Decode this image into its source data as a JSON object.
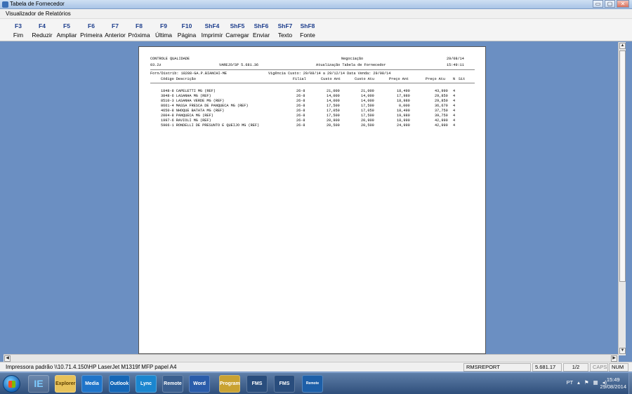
{
  "window": {
    "title": "Tabela de Fornecedor",
    "controls": {
      "minimize": "▭",
      "maximize": "▢",
      "close": "✕"
    }
  },
  "menu": {
    "items": [
      "Visualizador de Relatórios"
    ]
  },
  "toolbar": {
    "keys": [
      {
        "key": "F3",
        "label": "Fim"
      },
      {
        "key": "F4",
        "label": "Reduzir"
      },
      {
        "key": "F5",
        "label": "Ampliar"
      },
      {
        "key": "F6",
        "label": "Primeira"
      },
      {
        "key": "F7",
        "label": "Anterior"
      },
      {
        "key": "F8",
        "label": "Próxima"
      },
      {
        "key": "F9",
        "label": "Última"
      },
      {
        "key": "F10",
        "label": "Página"
      },
      {
        "key": "ShF4",
        "label": "Imprimir"
      },
      {
        "key": "ShF5",
        "label": "Carregar"
      },
      {
        "key": "ShF6",
        "label": "Enviar"
      },
      {
        "key": "ShF7",
        "label": "Texto"
      },
      {
        "key": "ShF8",
        "label": "Fonte"
      }
    ]
  },
  "report": {
    "company": "CONTROLE QUALIDADE",
    "negotiation_label": "Negociação",
    "date": "29/08/14",
    "version_code": "03.2z",
    "system_version": "VAREJO/SP 5.681.36",
    "report_title": "Atualização Tabela de Fornecedor",
    "time": "15:49:11",
    "supplier_line": "Forn/Distrib: 18288-GA.P.BIANCHI-ME",
    "validity_line": "Vigência Custo: 29/08/14 a 29/12/14  Data Venda: 29/08/14",
    "columns": {
      "code_desc": "Código Descrição",
      "filial": "Filial",
      "custo_ant": "Custo Ant",
      "custo_atu": "Custo Atu",
      "preco_ant": "Preço Ant",
      "preco_atu": "Preço Atu",
      "n": "N",
      "sit": "Sit"
    },
    "rows": [
      {
        "desc": "1848-8 CAPELETTI MG (REF)",
        "filial": "26-8",
        "custo_ant": "21,000",
        "custo_atu": "21,000",
        "preco_ant": "18,490",
        "preco_atu": "43,990",
        "n": "4"
      },
      {
        "desc": "3848-6 LASANHA MG (REF)",
        "filial": "26-8",
        "custo_ant": "14,000",
        "custo_atu": "14,000",
        "preco_ant": "17,980",
        "preco_atu": "29,850",
        "n": "4"
      },
      {
        "desc": "8510-3 LASANHA VERDE MG (REF)",
        "filial": "26-8",
        "custo_ant": "14,000",
        "custo_atu": "14,000",
        "preco_ant": "18,980",
        "preco_atu": "29,850",
        "n": "4"
      },
      {
        "desc": "8661-4 MASSA FRESCA DE PANQUECA MG (REF)",
        "filial": "26-8",
        "custo_ant": "17,500",
        "custo_atu": "17,500",
        "preco_ant": "0,000",
        "preco_atu": "36,670",
        "n": "4"
      },
      {
        "desc": "4650-8 NHOQUE BATATA MG (REF)",
        "filial": "26-8",
        "custo_ant": "17,050",
        "custo_atu": "17,050",
        "preco_ant": "18,490",
        "preco_atu": "37,750",
        "n": "4"
      },
      {
        "desc": "2004-8 PANQUECA MG (REF)",
        "filial": "26-8",
        "custo_ant": "17,500",
        "custo_atu": "17,500",
        "preco_ant": "19,980",
        "preco_atu": "39,750",
        "n": "4"
      },
      {
        "desc": "1997-6 RAVIOLI MG (REF)",
        "filial": "26-8",
        "custo_ant": "20,900",
        "custo_atu": "20,900",
        "preco_ant": "18,990",
        "preco_atu": "42,990",
        "n": "4"
      },
      {
        "desc": "5906-1 RONDELLI DE PRESUNTO E QUEIJO MG (REF)",
        "filial": "26-8",
        "custo_ant": "20,500",
        "custo_atu": "20,500",
        "preco_ant": "24,990",
        "preco_atu": "42,990",
        "n": "4"
      }
    ]
  },
  "status": {
    "printer": "Impressora padrão \\\\10.71.4.150\\HP LaserJet M1319f MFP papel A4",
    "report_name": "RMSREPORT",
    "version": "5.681.17",
    "page": "1/2",
    "caps": "CAPS",
    "num": "NUM"
  },
  "taskbar": {
    "buttons": [
      "IE",
      "Explorer",
      "Media",
      "Outlook",
      "Lync",
      "Remote",
      "Word",
      "Program",
      "FMS",
      "FMS",
      "Remote Desktop"
    ],
    "tray_lang": "PT",
    "time": "15:49",
    "date": "29/08/2014"
  },
  "colors": {
    "desktop": "#6b8fc2",
    "key_blue": "#1c3d8c"
  }
}
